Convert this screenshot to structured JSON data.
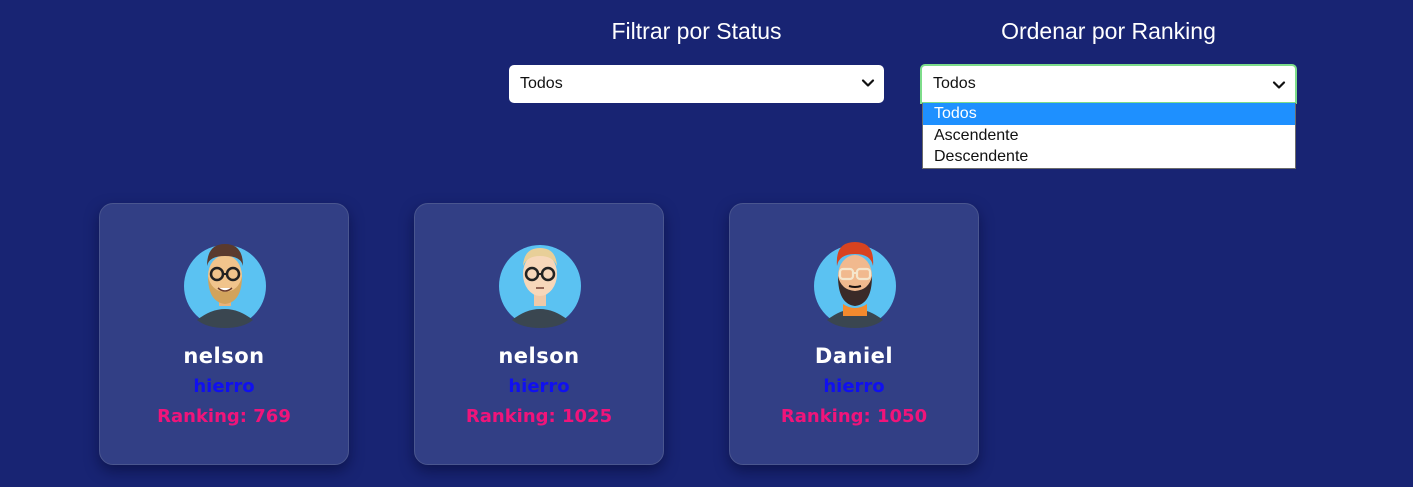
{
  "filters": {
    "status": {
      "label": "Filtrar por Status",
      "selected": "Todos"
    },
    "ranking": {
      "label": "Ordenar por Ranking",
      "selected": "Todos",
      "options": [
        "Todos",
        "Ascendente",
        "Descendente"
      ]
    }
  },
  "cards": [
    {
      "name": "nelson",
      "status": "hierro",
      "ranking": "Ranking: 769",
      "avatar": "bearded-man-glasses-avatar-icon"
    },
    {
      "name": "nelson",
      "status": "hierro",
      "ranking": "Ranking: 1025",
      "avatar": "bald-man-glasses-avatar-icon"
    },
    {
      "name": "Daniel",
      "status": "hierro",
      "ranking": "Ranking: 1050",
      "avatar": "redhead-bearded-man-avatar-icon"
    }
  ],
  "colors": {
    "background": "#182473",
    "card": "#323f85",
    "status_text": "#1010f0",
    "ranking_text": "#f0147a",
    "dropdown_highlight": "#1e90ff",
    "focus_border": "#7ddc8a"
  }
}
